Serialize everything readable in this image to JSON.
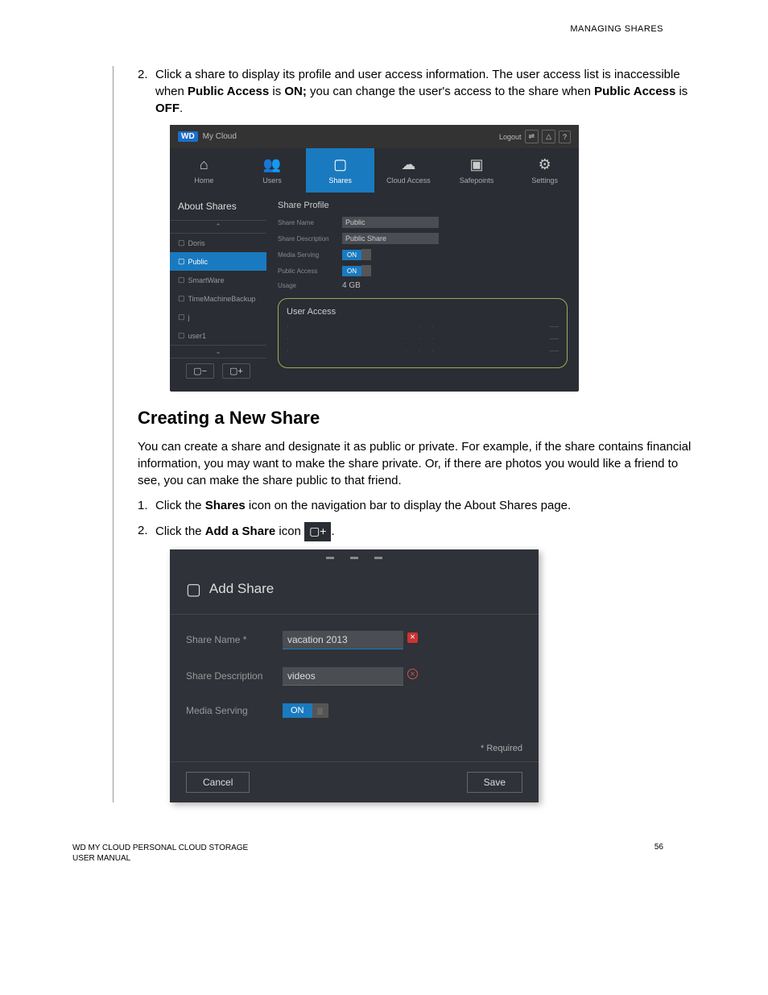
{
  "header": {
    "section": "MANAGING SHARES"
  },
  "step2": {
    "num": "2.",
    "text_a": "Click a share to display its profile and user access information. The user access list is inaccessible when ",
    "bold_a": "Public Access",
    "text_b": " is ",
    "bold_b": "ON;",
    "text_c": " you can change the user's access to the share when ",
    "bold_c": "Public Access",
    "text_d": " is ",
    "bold_d": "OFF",
    "text_e": "."
  },
  "sc1": {
    "brand": "WD",
    "product": "My Cloud",
    "logout": "Logout",
    "nav": {
      "home": "Home",
      "users": "Users",
      "shares": "Shares",
      "cloud": "Cloud Access",
      "safepoints": "Safepoints",
      "settings": "Settings"
    },
    "about": "About Shares",
    "shares_list": [
      "Doris",
      "Public",
      "SmartWare",
      "TimeMachineBackup",
      "j",
      "user1"
    ],
    "profile_title": "Share Profile",
    "fields": {
      "name_label": "Share Name",
      "name_value": "Public",
      "desc_label": "Share Description",
      "desc_value": "Public Share",
      "media_label": "Media Serving",
      "public_label": "Public Access",
      "usage_label": "Usage",
      "usage_value": "4 GB",
      "on": "ON"
    },
    "user_access_title": "User Access"
  },
  "heading": "Creating a New Share",
  "intro": "You can create a share and designate it as public or private. For example, if the share contains financial information, you may want to make the share private. Or, if there are photos you would like a friend to see, you can make the share public to that friend.",
  "create1": {
    "num": "1.",
    "text_a": "Click the ",
    "bold_a": "Shares",
    "text_b": " icon on the navigation bar to display the About Shares page."
  },
  "create2": {
    "num": "2.",
    "text_a": "Click the ",
    "bold_a": "Add a Share",
    "text_b": " icon ",
    "text_c": "."
  },
  "sc2": {
    "title": "Add Share",
    "name_label": "Share Name *",
    "name_value": "vacation 2013",
    "desc_label": "Share Description",
    "desc_value": "videos",
    "media_label": "Media Serving",
    "on": "ON",
    "required": "* Required",
    "cancel": "Cancel",
    "save": "Save"
  },
  "footer": {
    "line1": "WD MY CLOUD PERSONAL CLOUD STORAGE",
    "line2": "USER MANUAL",
    "page": "56"
  }
}
